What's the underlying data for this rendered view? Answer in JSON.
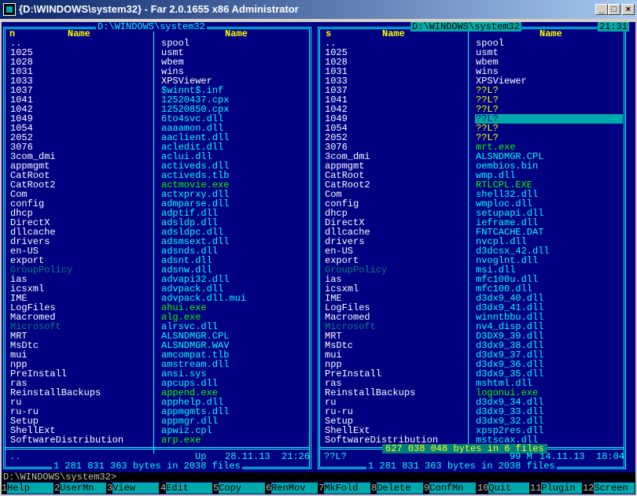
{
  "window": {
    "title": "{D:\\WINDOWS\\system32} - Far 2.0.1655 x86 Administrator",
    "minimize": "_",
    "maximize": "□",
    "close": "×"
  },
  "left_panel": {
    "path": "D:\\WINDOWS\\system32",
    "col1_header_prefix": "n",
    "col_header": "Name",
    "col1": [
      {
        "t": "..",
        "c": "c-dir"
      },
      {
        "t": "1025",
        "c": "c-dir"
      },
      {
        "t": "1028",
        "c": "c-dir"
      },
      {
        "t": "1031",
        "c": "c-dir"
      },
      {
        "t": "1033",
        "c": "c-dir"
      },
      {
        "t": "1037",
        "c": "c-dir"
      },
      {
        "t": "1041",
        "c": "c-dir"
      },
      {
        "t": "1042",
        "c": "c-dir"
      },
      {
        "t": "1049",
        "c": "c-dir"
      },
      {
        "t": "1054",
        "c": "c-dir"
      },
      {
        "t": "2052",
        "c": "c-dir"
      },
      {
        "t": "3076",
        "c": "c-dir"
      },
      {
        "t": "3com_dmi",
        "c": "c-dir"
      },
      {
        "t": "appmgmt",
        "c": "c-dir"
      },
      {
        "t": "CatRoot",
        "c": "c-dir"
      },
      {
        "t": "CatRoot2",
        "c": "c-dir"
      },
      {
        "t": "Com",
        "c": "c-dir"
      },
      {
        "t": "config",
        "c": "c-dir"
      },
      {
        "t": "dhcp",
        "c": "c-dir"
      },
      {
        "t": "DirectX",
        "c": "c-dir"
      },
      {
        "t": "dllcache",
        "c": "c-dir"
      },
      {
        "t": "drivers",
        "c": "c-dir"
      },
      {
        "t": "en-US",
        "c": "c-dir"
      },
      {
        "t": "export",
        "c": "c-dir"
      },
      {
        "t": "GroupPolicy",
        "c": "c-dim"
      },
      {
        "t": "ias",
        "c": "c-dir"
      },
      {
        "t": "icsxml",
        "c": "c-dir"
      },
      {
        "t": "IME",
        "c": "c-dir"
      },
      {
        "t": "LogFiles",
        "c": "c-dir"
      },
      {
        "t": "Macromed",
        "c": "c-dir"
      },
      {
        "t": "Microsoft",
        "c": "c-dim"
      },
      {
        "t": "MRT",
        "c": "c-dir"
      },
      {
        "t": "MsDtc",
        "c": "c-dir"
      },
      {
        "t": "mui",
        "c": "c-dir"
      },
      {
        "t": "npp",
        "c": "c-dir"
      },
      {
        "t": "PreInstall",
        "c": "c-dir"
      },
      {
        "t": "ras",
        "c": "c-dir"
      },
      {
        "t": "ReinstallBackups",
        "c": "c-dir"
      },
      {
        "t": "ru",
        "c": "c-dir"
      },
      {
        "t": "ru-ru",
        "c": "c-dir"
      },
      {
        "t": "Setup",
        "c": "c-dir"
      },
      {
        "t": "ShellExt",
        "c": "c-dir"
      },
      {
        "t": "SoftwareDistribution",
        "c": "c-dir"
      }
    ],
    "col2": [
      {
        "t": "spool",
        "c": "c-dir"
      },
      {
        "t": "usmt",
        "c": "c-dir"
      },
      {
        "t": "wbem",
        "c": "c-dir"
      },
      {
        "t": "wins",
        "c": "c-dir"
      },
      {
        "t": "XPSViewer",
        "c": "c-dir"
      },
      {
        "t": "$winnt$.inf",
        "c": "c-file"
      },
      {
        "t": "12520437.cpx",
        "c": "c-file"
      },
      {
        "t": "12520850.cpx",
        "c": "c-file"
      },
      {
        "t": "6to4svc.dll",
        "c": "c-file"
      },
      {
        "t": "aaaamon.dll",
        "c": "c-file"
      },
      {
        "t": "aaclient.dll",
        "c": "c-file"
      },
      {
        "t": "acledit.dll",
        "c": "c-file"
      },
      {
        "t": "aclui.dll",
        "c": "c-file"
      },
      {
        "t": "activeds.dll",
        "c": "c-file"
      },
      {
        "t": "activeds.tlb",
        "c": "c-file"
      },
      {
        "t": "actmovie.exe",
        "c": "c-exe"
      },
      {
        "t": "actxprxy.dll",
        "c": "c-file"
      },
      {
        "t": "admparse.dll",
        "c": "c-file"
      },
      {
        "t": "adptif.dll",
        "c": "c-file"
      },
      {
        "t": "adsldp.dll",
        "c": "c-file"
      },
      {
        "t": "adsldpc.dll",
        "c": "c-file"
      },
      {
        "t": "adsmsext.dll",
        "c": "c-file"
      },
      {
        "t": "adsnds.dll",
        "c": "c-file"
      },
      {
        "t": "adsnt.dll",
        "c": "c-file"
      },
      {
        "t": "adsnw.dll",
        "c": "c-file"
      },
      {
        "t": "advapi32.dll",
        "c": "c-file"
      },
      {
        "t": "advpack.dll",
        "c": "c-file"
      },
      {
        "t": "advpack.dll.mui",
        "c": "c-file"
      },
      {
        "t": "ahui.exe",
        "c": "c-exe"
      },
      {
        "t": "alg.exe",
        "c": "c-exe"
      },
      {
        "t": "alrsvc.dll",
        "c": "c-file"
      },
      {
        "t": "ALSNDMGR.CPL",
        "c": "c-file"
      },
      {
        "t": "ALSNDMGR.WAV",
        "c": "c-file"
      },
      {
        "t": "amcompat.tlb",
        "c": "c-file"
      },
      {
        "t": "amstream.dll",
        "c": "c-file"
      },
      {
        "t": "ansi.sys",
        "c": "c-file"
      },
      {
        "t": "apcups.dll",
        "c": "c-file"
      },
      {
        "t": "append.exe",
        "c": "c-exe"
      },
      {
        "t": "apphelp.dll",
        "c": "c-file"
      },
      {
        "t": "appmgmts.dll",
        "c": "c-file"
      },
      {
        "t": "appmgr.dll",
        "c": "c-file"
      },
      {
        "t": "apwiz.cpl",
        "c": "c-file"
      },
      {
        "t": "arp.exe",
        "c": "c-exe"
      }
    ],
    "footer_name": "..",
    "footer_up": "Up",
    "footer_date": "28.11.13",
    "footer_time": "21:26",
    "summary": "1 281 831 363 bytes in 2038 files"
  },
  "right_panel": {
    "path": "D:\\WINDOWS\\system32",
    "clock": "21:31",
    "col1_header_prefix": "s",
    "col_header": "Name",
    "col1": [
      {
        "t": "..",
        "c": "c-dir"
      },
      {
        "t": "1025",
        "c": "c-dir"
      },
      {
        "t": "1028",
        "c": "c-dir"
      },
      {
        "t": "1031",
        "c": "c-dir"
      },
      {
        "t": "1033",
        "c": "c-dir"
      },
      {
        "t": "1037",
        "c": "c-dir"
      },
      {
        "t": "1041",
        "c": "c-dir"
      },
      {
        "t": "1042",
        "c": "c-dir"
      },
      {
        "t": "1049",
        "c": "c-dir"
      },
      {
        "t": "1054",
        "c": "c-dir"
      },
      {
        "t": "2052",
        "c": "c-dir"
      },
      {
        "t": "3076",
        "c": "c-dir"
      },
      {
        "t": "3com_dmi",
        "c": "c-dir"
      },
      {
        "t": "appmgmt",
        "c": "c-dir"
      },
      {
        "t": "CatRoot",
        "c": "c-dir"
      },
      {
        "t": "CatRoot2",
        "c": "c-dir"
      },
      {
        "t": "Com",
        "c": "c-dir"
      },
      {
        "t": "config",
        "c": "c-dir"
      },
      {
        "t": "dhcp",
        "c": "c-dir"
      },
      {
        "t": "DirectX",
        "c": "c-dir"
      },
      {
        "t": "dllcache",
        "c": "c-dir"
      },
      {
        "t": "drivers",
        "c": "c-dir"
      },
      {
        "t": "en-US",
        "c": "c-dir"
      },
      {
        "t": "export",
        "c": "c-dir"
      },
      {
        "t": "GroupPolicy",
        "c": "c-dim"
      },
      {
        "t": "ias",
        "c": "c-dir"
      },
      {
        "t": "icsxml",
        "c": "c-dir"
      },
      {
        "t": "IME",
        "c": "c-dir"
      },
      {
        "t": "LogFiles",
        "c": "c-dir"
      },
      {
        "t": "Macromed",
        "c": "c-dir"
      },
      {
        "t": "Microsoft",
        "c": "c-dim"
      },
      {
        "t": "MRT",
        "c": "c-dir"
      },
      {
        "t": "MsDtc",
        "c": "c-dir"
      },
      {
        "t": "mui",
        "c": "c-dir"
      },
      {
        "t": "npp",
        "c": "c-dir"
      },
      {
        "t": "PreInstall",
        "c": "c-dir"
      },
      {
        "t": "ras",
        "c": "c-dir"
      },
      {
        "t": "ReinstallBackups",
        "c": "c-dir"
      },
      {
        "t": "ru",
        "c": "c-dir"
      },
      {
        "t": "ru-ru",
        "c": "c-dir"
      },
      {
        "t": "Setup",
        "c": "c-dir"
      },
      {
        "t": "ShellExt",
        "c": "c-dir"
      },
      {
        "t": "SoftwareDistribution",
        "c": "c-dir"
      }
    ],
    "col2": [
      {
        "t": "spool",
        "c": "c-dir"
      },
      {
        "t": "usmt",
        "c": "c-dir"
      },
      {
        "t": "wbem",
        "c": "c-dir"
      },
      {
        "t": "wins",
        "c": "c-dir"
      },
      {
        "t": "XPSViewer",
        "c": "c-dir"
      },
      {
        "t": "??L?",
        "c": "c-yel"
      },
      {
        "t": "??L?",
        "c": "c-yel"
      },
      {
        "t": "??L?",
        "c": "c-yel"
      },
      {
        "t": "??L?",
        "c": "c-yel cursor"
      },
      {
        "t": "??L?",
        "c": "c-yel"
      },
      {
        "t": "??L?",
        "c": "c-yel"
      },
      {
        "t": "mrt.exe",
        "c": "c-exe"
      },
      {
        "t": "ALSNDMGR.CPL",
        "c": "c-file"
      },
      {
        "t": "oembios.bin",
        "c": "c-file"
      },
      {
        "t": "wmp.dll",
        "c": "c-file"
      },
      {
        "t": "RTLCPL.EXE",
        "c": "c-exe"
      },
      {
        "t": "shell32.dll",
        "c": "c-file"
      },
      {
        "t": "wmploc.dll",
        "c": "c-file"
      },
      {
        "t": "setupapi.dll",
        "c": "c-file"
      },
      {
        "t": "ieframe.dll",
        "c": "c-file"
      },
      {
        "t": "FNTCACHE.DAT",
        "c": "c-file"
      },
      {
        "t": "nvcpl.dll",
        "c": "c-file"
      },
      {
        "t": "d3dcsx_42.dll",
        "c": "c-file"
      },
      {
        "t": "nvoglnt.dll",
        "c": "c-file"
      },
      {
        "t": "msi.dll",
        "c": "c-file"
      },
      {
        "t": "mfc100u.dll",
        "c": "c-file"
      },
      {
        "t": "mfc100.dll",
        "c": "c-file"
      },
      {
        "t": "d3dx9_40.dll",
        "c": "c-file"
      },
      {
        "t": "d3dx9_41.dll",
        "c": "c-file"
      },
      {
        "t": "winntbbu.dll",
        "c": "c-file"
      },
      {
        "t": "nv4_disp.dll",
        "c": "c-file"
      },
      {
        "t": "D3DX9_39.dll",
        "c": "c-file"
      },
      {
        "t": "d3dx9_38.dll",
        "c": "c-file"
      },
      {
        "t": "d3dx9_37.dll",
        "c": "c-file"
      },
      {
        "t": "d3dx9_36.dll",
        "c": "c-file"
      },
      {
        "t": "d3dx9_35.dll",
        "c": "c-file"
      },
      {
        "t": "mshtml.dll",
        "c": "c-file"
      },
      {
        "t": "logonui.exe",
        "c": "c-exe"
      },
      {
        "t": "d3dx9_34.dll",
        "c": "c-file"
      },
      {
        "t": "d3dx9_33.dll",
        "c": "c-file"
      },
      {
        "t": "d3dx9_32.dll",
        "c": "c-file"
      },
      {
        "t": "xpsp2res.dll",
        "c": "c-file"
      },
      {
        "t": "mstscax.dll",
        "c": "c-file"
      }
    ],
    "footer_name": "??L?",
    "footer_size": "99 M",
    "footer_date": "14.11.13",
    "footer_time": "18:04",
    "selected_summary": "627 038 048 bytes in 6 files",
    "summary": "1 281 831 363 bytes in 2038 files"
  },
  "command_line": "D:\\WINDOWS\\system32>",
  "keybar": [
    {
      "n": "1",
      "l": "Help"
    },
    {
      "n": "2",
      "l": "UserMn"
    },
    {
      "n": "3",
      "l": "View"
    },
    {
      "n": "4",
      "l": "Edit"
    },
    {
      "n": "5",
      "l": "Copy"
    },
    {
      "n": "6",
      "l": "RenMov"
    },
    {
      "n": "7",
      "l": "MkFold"
    },
    {
      "n": "8",
      "l": "Delete"
    },
    {
      "n": "9",
      "l": "ConfMn"
    },
    {
      "n": "10",
      "l": "Quit"
    },
    {
      "n": "11",
      "l": "Plugin"
    },
    {
      "n": "12",
      "l": "Screen"
    }
  ],
  "colors": {
    "panel_bg": "#000080",
    "frame": "#00ffff",
    "directory": "#ffffff",
    "file": "#00ffff",
    "executable": "#00ff00",
    "header": "#ffff00",
    "cursor": "#00aaaa"
  }
}
